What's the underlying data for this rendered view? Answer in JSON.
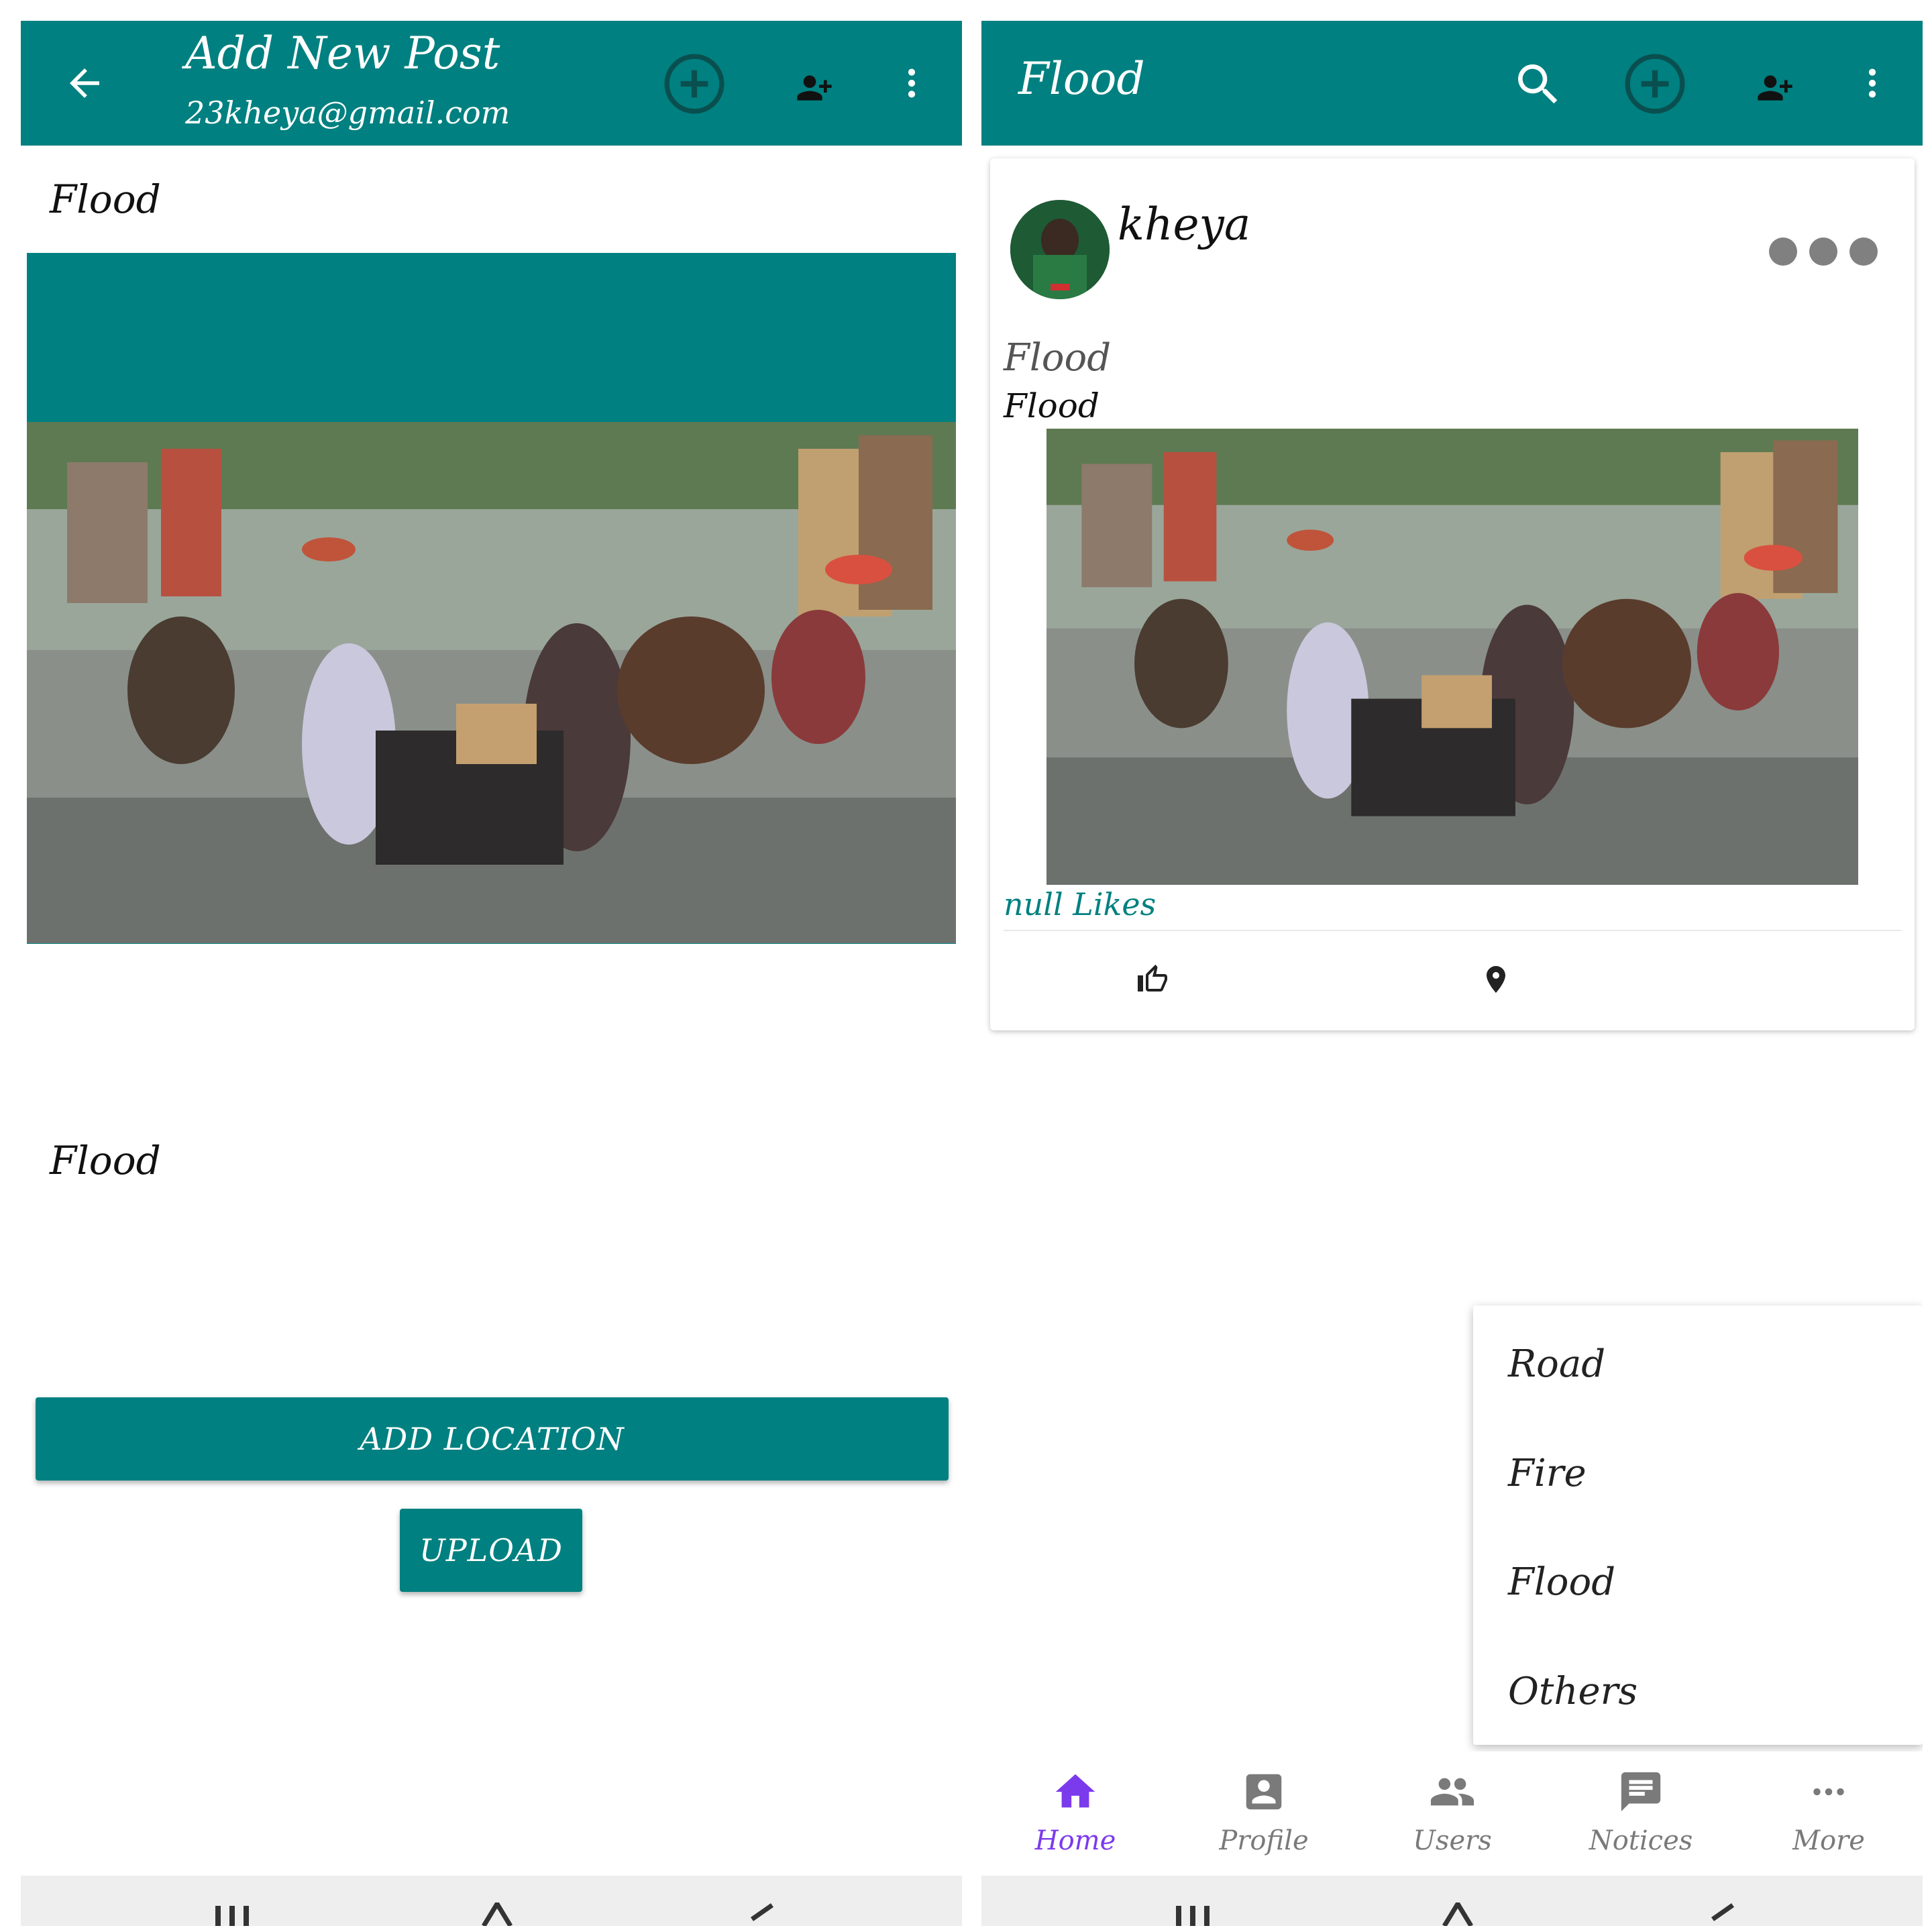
{
  "left_screen": {
    "appbar": {
      "title": "Add New Post",
      "subtitle": "23kheya@gmail.com",
      "icons": [
        "arrow-back-icon",
        "add-circle-icon",
        "person-add-icon",
        "more-vert-icon"
      ]
    },
    "title_field_value": "Flood",
    "image_description_value": "Flood",
    "add_location_label": "ADD LOCATION",
    "upload_label": "UPLOAD"
  },
  "right_screen": {
    "appbar": {
      "title": "Flood",
      "icons": [
        "search-icon",
        "add-circle-icon",
        "person-add-icon",
        "more-vert-icon"
      ]
    },
    "post": {
      "username": "kheya",
      "title": "Flood",
      "description": "Flood",
      "likes_text": "null Likes",
      "actions": [
        "like-icon",
        "location-pin-icon"
      ]
    },
    "category_menu": [
      "Road",
      "Fire",
      "Flood",
      "Others"
    ],
    "bottom_nav": [
      {
        "label": "Home",
        "icon": "home-icon",
        "active": true
      },
      {
        "label": "Profile",
        "icon": "profile-icon",
        "active": false
      },
      {
        "label": "Users",
        "icon": "users-icon",
        "active": false
      },
      {
        "label": "Notices",
        "icon": "notices-icon",
        "active": false
      },
      {
        "label": "More",
        "icon": "more-horiz-icon",
        "active": false
      }
    ]
  },
  "colors": {
    "primary": "#008080",
    "active_nav": "#7c3aed",
    "inactive_nav": "#7a7a7a"
  }
}
